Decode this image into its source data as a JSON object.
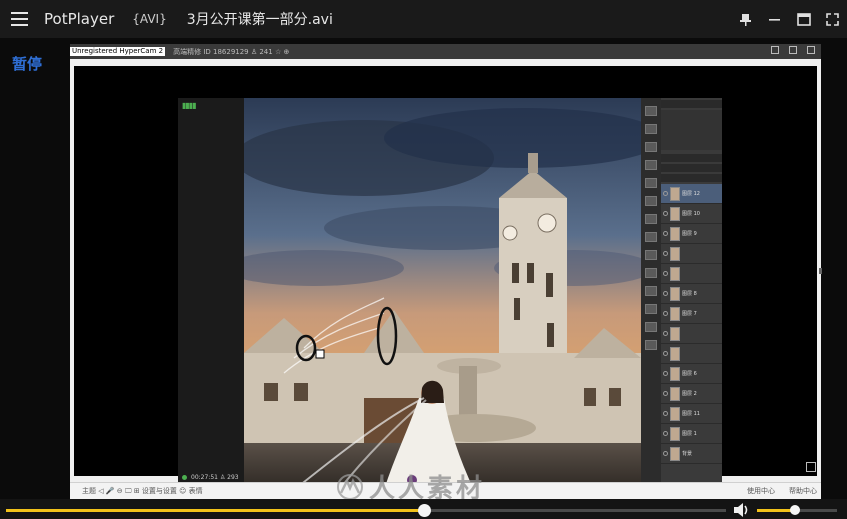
{
  "titlebar": {
    "app_name": "PotPlayer",
    "format": "{AVI}",
    "file_name": "3月公开课第一部分.avi"
  },
  "status_text": "暂停",
  "recording": {
    "watermark": "Unregistered HyperCam 2",
    "header_text": "高端精修 ID 18629129 ♙ 241 ☆ ⊕",
    "timer": "00:27:51 ♙ 293",
    "footer_left": "主题 ◁ 🎤 ⊖ 🖵 ⊞ 设置与设置 ☺ 表情",
    "footer_right": [
      "使用中心",
      "帮助中心"
    ],
    "site_watermark": "人人素材",
    "ps_layers": [
      "图层 12",
      "图层 10",
      "图层 9",
      "",
      "",
      "图层 8",
      "图层 7",
      "",
      "",
      "图层 6",
      "图层 2",
      "图层 11",
      "图层 1",
      "背景"
    ]
  },
  "playback": {
    "progress": 0.58,
    "volume": 0.48
  },
  "colors": {
    "accent": "#f2c21a",
    "status": "#2f6fd6"
  },
  "icons": {
    "menu": "hamburger-icon",
    "pin": "pin-icon",
    "minimize": "minimize-icon",
    "maximize": "maximize-icon",
    "fullscreen": "fullscreen-icon",
    "volume": "speaker-icon"
  }
}
